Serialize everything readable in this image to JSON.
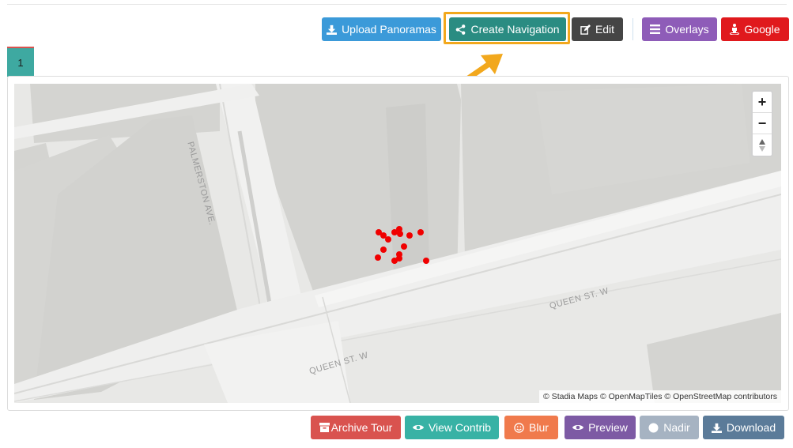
{
  "toolbar": {
    "upload_panoramas": "Upload Panoramas",
    "create_navigation": "Create Navigation",
    "edit": "Edit",
    "overlays": "Overlays",
    "google": "Google"
  },
  "tabs": [
    {
      "label": "1"
    }
  ],
  "map": {
    "attribution": "© Stadia Maps © OpenMapTiles © OpenStreetMap contributors",
    "zoom_in": "+",
    "zoom_out": "−",
    "streets": {
      "palmerston": "PALMERSTON AVE.",
      "queen_upper": "QUEEN ST. W",
      "queen_lower": "QUEEN ST. W"
    }
  },
  "bottom_toolbar": {
    "archive_tour": "Archive Tour",
    "view_contrib": "View Contrib",
    "blur": "Blur",
    "preview": "Preview",
    "nadir": "Nadir",
    "download": "Download"
  },
  "colors": {
    "upload": "#3b9ad9",
    "create_navigation": "#2a8c82",
    "edit": "#454545",
    "overlays": "#8e5cb8",
    "google": "#e0191d",
    "archive": "#d9534f",
    "view_contrib": "#38b2a5",
    "blur": "#f07a4c",
    "preview": "#7d5aa4",
    "nadir": "#a6b3c2",
    "download": "#5b7b99",
    "highlight": "#f2a81d",
    "marker": "#f00000"
  },
  "icons": {
    "upload": "download-icon",
    "create_navigation": "share-icon",
    "edit": "edit-icon",
    "overlays": "list-icon",
    "google": "street-view-icon",
    "archive": "archive-icon",
    "view_contrib": "eye-icon",
    "blur": "smile-icon",
    "preview": "eye-icon",
    "nadir": "circle-icon",
    "download": "download-icon"
  }
}
